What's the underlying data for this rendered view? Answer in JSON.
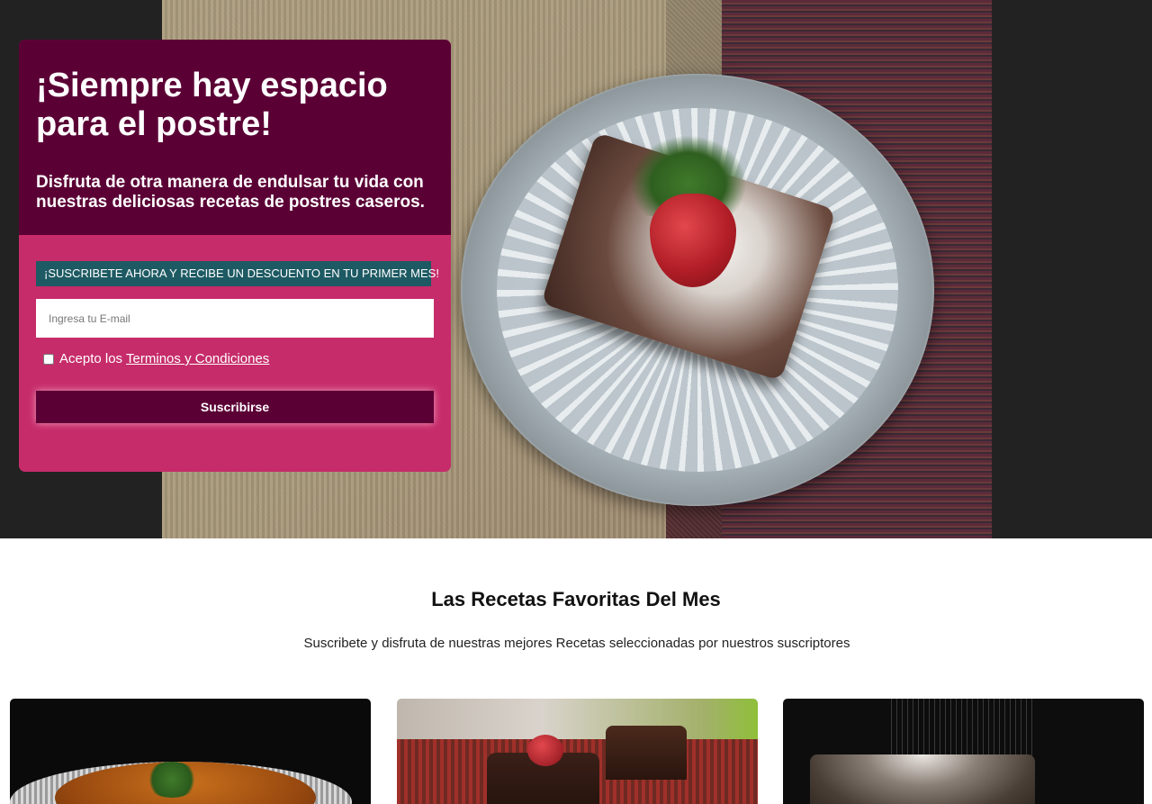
{
  "hero": {
    "headline": "¡Siempre hay espacio para el postre!",
    "subheadline": "Disfruta de otra manera de endulsar tu vida con nuestras deliciosas recetas de postres caseros.",
    "image": "chocolate-brownie-with-strawberry-on-plate"
  },
  "subscribe": {
    "promo_label": "¡SUSCRIBETE AHORA Y RECIBE UN DESCUENTO EN TU PRIMER MES!",
    "email_placeholder": "Ingresa tu E-mail",
    "email_value": "",
    "terms_prefix": "Acepto los",
    "terms_link": "Terminos y Condiciones",
    "terms_checked": false,
    "button_label": "Suscribirse"
  },
  "recipes": {
    "title": "Las Recetas Favoritas Del Mes",
    "subtitle": "Suscribete y disfruta de nuestras mejores Recetas seleccionadas por nuestros suscriptores",
    "cards": [
      {
        "image": "flan-with-mint"
      },
      {
        "image": "chocolate-mini-cakes-with-strawberry"
      },
      {
        "image": "brownie-with-powdered-sugar"
      }
    ]
  },
  "colors": {
    "card_top": "#5b0035",
    "card_bottom": "#c62c6a",
    "promo_bg": "#1e5a63",
    "button_bg": "#5b0035",
    "hero_bg": "#222222"
  }
}
